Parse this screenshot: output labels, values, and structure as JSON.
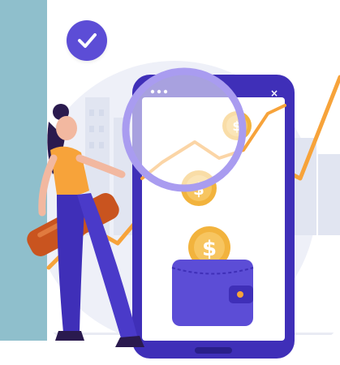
{
  "scene": {
    "description_icons": [
      "check-icon",
      "close-icon",
      "dollar-coin-icon",
      "wallet-icon",
      "magnifier-icon",
      "trend-line-icon"
    ],
    "colors": {
      "accent_purple": "#5c4dd6",
      "phone_dark": "#3f2fb8",
      "orange": "#f7a33a",
      "coin_gold": "#f2b33d",
      "teal_strip": "#8fbfcc",
      "handle_brown": "#c9541f"
    }
  },
  "phone": {
    "close_glyph": "×"
  },
  "coins": {
    "symbol": "$"
  }
}
